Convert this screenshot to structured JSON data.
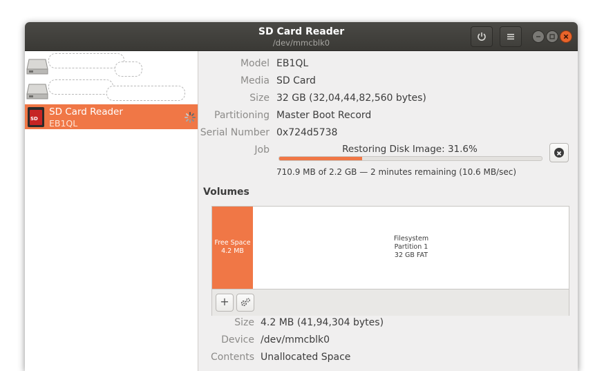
{
  "window": {
    "title": "SD Card Reader",
    "subtitle": "/dev/mmcblk0"
  },
  "header_buttons": {
    "power_icon": "power-icon",
    "menu_icon": "hamburger-menu-icon"
  },
  "sidebar": {
    "drives": [
      {
        "icon": "hard-disk-icon",
        "name": "",
        "redacted": true
      },
      {
        "icon": "hard-disk-icon",
        "name": "",
        "redacted": true
      },
      {
        "icon": "sd-card-icon",
        "icon_text": "SD",
        "name": "SD Card Reader",
        "subtitle": "EB1QL",
        "selected": true,
        "busy": true
      }
    ]
  },
  "details": {
    "model_label": "Model",
    "model": "EB1QL",
    "media_label": "Media",
    "media": "SD Card",
    "size_label": "Size",
    "size": "32 GB (32,04,44,82,560 bytes)",
    "partitioning_label": "Partitioning",
    "partitioning": "Master Boot Record",
    "serial_label": "Serial Number",
    "serial": "0x724d5738",
    "job_label": "Job",
    "job_text": "Restoring Disk Image: 31.6%",
    "job_progress_percent": 31.6,
    "job_detail": "710.9 MB of 2.2 GB — 2 minutes remaining (10.6 MB/sec)"
  },
  "volumes": {
    "heading": "Volumes",
    "segments": [
      {
        "line1": "Free Space",
        "line2": "4.2 MB",
        "color": "#f07746"
      },
      {
        "line1": "Filesystem",
        "line2": "Partition 1",
        "line3": "32 GB FAT"
      }
    ],
    "add_label": "+",
    "settings_icon": "gears-icon"
  },
  "volume_details": {
    "size_label": "Size",
    "size": "4.2 MB (41,94,304 bytes)",
    "device_label": "Device",
    "device": "/dev/mmcblk0",
    "contents_label": "Contents",
    "contents": "Unallocated Space"
  },
  "colors": {
    "accent": "#f07746",
    "titlebar": "#3f3e3a",
    "close": "#e9642a"
  }
}
